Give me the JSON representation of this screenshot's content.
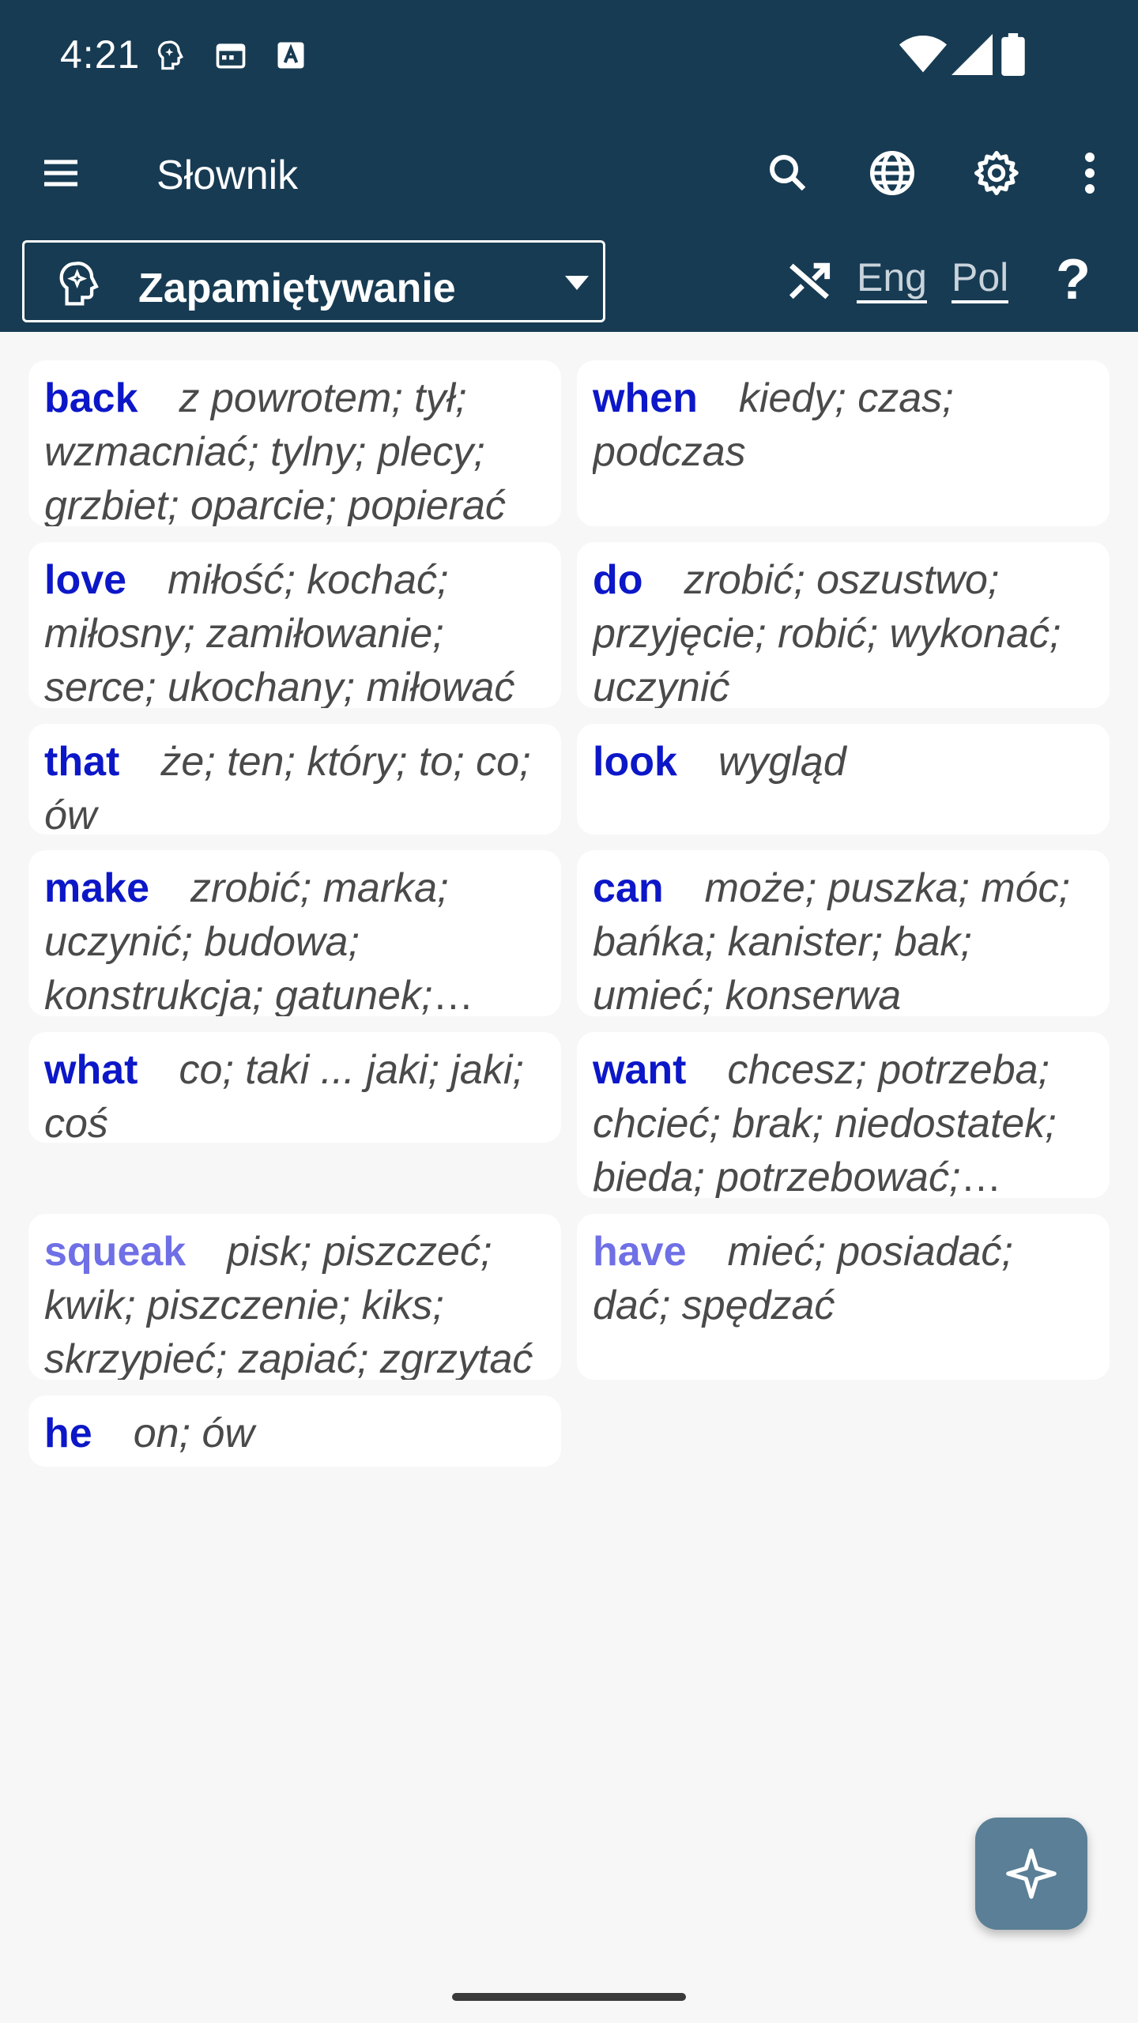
{
  "status": {
    "time": "4:21"
  },
  "toolbar": {
    "title": "Słownik"
  },
  "mode": {
    "selected": "Zapamiętywanie",
    "lang_source": "Eng",
    "lang_target": "Pol",
    "help": "?"
  },
  "cards": [
    {
      "word": "back",
      "translation": "z powrotem; tył; wzmacniać; tylny; plecy; grzbiet; oparcie; popierać"
    },
    {
      "word": "when",
      "translation": "kiedy; czas; podczas"
    },
    {
      "word": "love",
      "translation": "miłość; kochać; miłosny; zamiłowanie; serce; ukochany; miłować"
    },
    {
      "word": "do",
      "translation": "zrobić; oszustwo; przyjęcie; robić; wykonać; uczynić"
    },
    {
      "word": "that",
      "translation": "że; ten; który; to; co; ów"
    },
    {
      "word": "look",
      "translation": "wygląd"
    },
    {
      "word": "make",
      "translation": "zrobić; marka; uczynić; budowa; konstrukcja; gatunek; rodzaj"
    },
    {
      "word": "can",
      "translation": "może; puszka; móc; bańka; kanister; bak; umieć; konserwa"
    },
    {
      "word": "what",
      "translation": "co; taki ... jaki; jaki; coś"
    },
    {
      "word": "want",
      "translation": "chcesz; potrzeba; chcieć; brak; niedostatek; bieda; potrzebować; szukać"
    },
    {
      "word": "squeak",
      "translation": "pisk; piszczeć; kwik; piszczenie; kiks; skrzypieć; zapiać; zgrzytać"
    },
    {
      "word": "have",
      "translation": "mieć; posiadać; dać; spędzać"
    },
    {
      "word": "he",
      "translation": "on; ów"
    }
  ],
  "colors": {
    "header_bg": "#173b53",
    "word_color": "#0c17c8",
    "word_faded": "#6f6fe6",
    "fab_bg": "#5a7f96"
  }
}
